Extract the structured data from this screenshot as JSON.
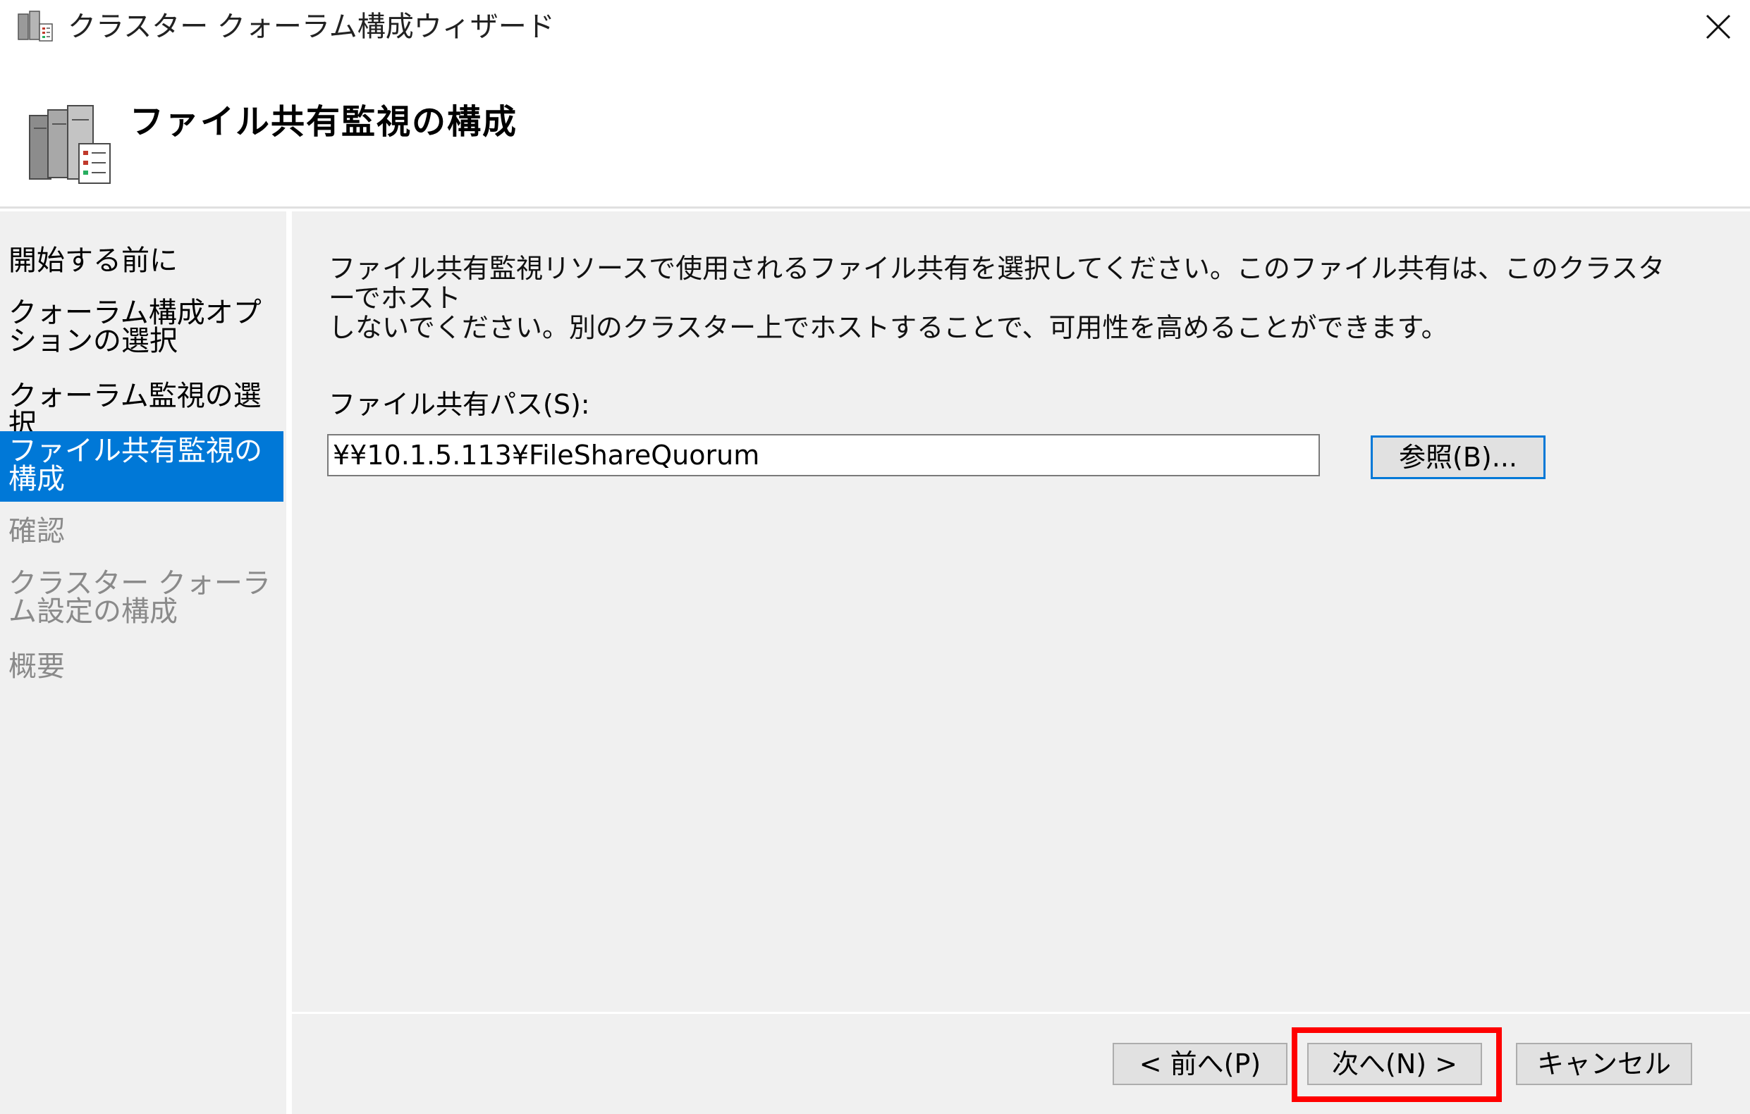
{
  "window": {
    "title": "クラスター クォーラム構成ウィザード",
    "close_symbol": "✕"
  },
  "header": {
    "title": "ファイル共有監視の構成"
  },
  "sidebar": {
    "items": [
      {
        "label": "開始する前に",
        "state": "normal"
      },
      {
        "label": "クォーラム構成オプションの選択",
        "state": "normal"
      },
      {
        "label": "クォーラム監視の選択",
        "state": "normal"
      },
      {
        "label": "ファイル共有監視の構成",
        "state": "active"
      },
      {
        "label": "確認",
        "state": "disabled"
      },
      {
        "label": "クラスター クォーラム設定の構成",
        "state": "disabled"
      },
      {
        "label": "概要",
        "state": "disabled"
      }
    ]
  },
  "main": {
    "description_line1": "ファイル共有監視リソースで使用されるファイル共有を選択してください。このファイル共有は、このクラスターでホスト",
    "description_line2": "しないでください。別のクラスター上でホストすることで、可用性を高めることができます。",
    "path_label": "ファイル共有パス(S):",
    "path_value": "¥¥10.1.5.113¥FileShareQuorum",
    "browse_label": "参照(B)..."
  },
  "footer": {
    "prev_label": "< 前へ(P)",
    "next_label": "次へ(N) >",
    "cancel_label": "キャンセル"
  },
  "colors": {
    "accent": "#0078d7",
    "highlight": "#ff0000",
    "panel": "#f0f0f0"
  }
}
